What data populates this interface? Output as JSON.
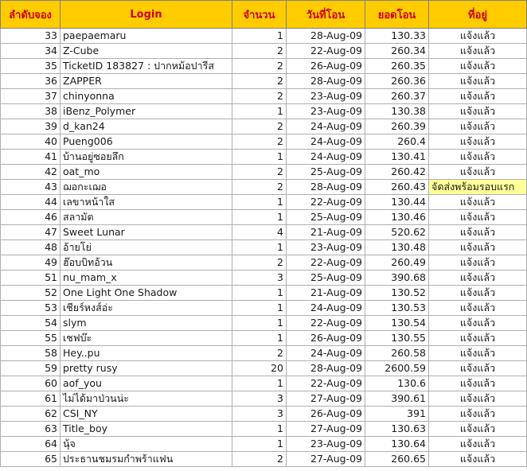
{
  "headers": [
    "ลำดับจอง",
    "Login",
    "จำนวน",
    "วันที่โอน",
    "ยอดโอน",
    "ที่อยู่"
  ],
  "highlight_color": "#ffff99",
  "header_bg": "#ffcc00",
  "header_text_color": "#cc0000",
  "rows": [
    [
      "33",
      "paepaemaru",
      "1",
      "28-Aug-09",
      "130.33",
      "แจ้งแล้ว"
    ],
    [
      "34",
      "Z-Cube",
      "2",
      "22-Aug-09",
      "260.34",
      "แจ้งแล้ว"
    ],
    [
      "35",
      "TicketID 183827 : ปากหม้อปารีส",
      "2",
      "26-Aug-09",
      "260.35",
      "แจ้งแล้ว"
    ],
    [
      "36",
      "ZAPPER",
      "2",
      "28-Aug-09",
      "260.36",
      "แจ้งแล้ว"
    ],
    [
      "37",
      "chinyonna",
      "2",
      "23-Aug-09",
      "260.37",
      "แจ้งแล้ว"
    ],
    [
      "38",
      "iBenz_Polymer",
      "1",
      "23-Aug-09",
      "130.38",
      "แจ้งแล้ว"
    ],
    [
      "39",
      "d_kan24",
      "2",
      "24-Aug-09",
      "260.39",
      "แจ้งแล้ว"
    ],
    [
      "40",
      "Pueng006",
      "2",
      "24-Aug-09",
      "260.4",
      "แจ้งแล้ว"
    ],
    [
      "41",
      "บ้านอยู่ซอยลึก",
      "1",
      "24-Aug-09",
      "130.41",
      "แจ้งแล้ว"
    ],
    [
      "42",
      "oat_mo",
      "2",
      "25-Aug-09",
      "260.42",
      "แจ้งแล้ว"
    ],
    [
      "43",
      "ฌอกะเฌอ",
      "2",
      "28-Aug-09",
      "260.43",
      "จัดส่งพร้อมรอบแรก"
    ],
    [
      "44",
      "เลขาหน้าใส",
      "1",
      "22-Aug-09",
      "130.44",
      "แจ้งแล้ว"
    ],
    [
      "46",
      "สลามัต",
      "1",
      "25-Aug-09",
      "130.46",
      "แจ้งแล้ว"
    ],
    [
      "47",
      "Sweet Lunar",
      "4",
      "21-Aug-09",
      "520.62",
      "แจ้งแล้ว"
    ],
    [
      "48",
      "อ้ายโย่",
      "1",
      "23-Aug-09",
      "130.48",
      "แจ้งแล้ว"
    ],
    [
      "49",
      "ฮ๊อบบิทอ้วน",
      "2",
      "22-Aug-09",
      "260.49",
      "แจ้งแล้ว"
    ],
    [
      "51",
      "nu_mam_x",
      "3",
      "25-Aug-09",
      "390.68",
      "แจ้งแล้ว"
    ],
    [
      "52",
      "One Light One Shadow",
      "1",
      "21-Aug-09",
      "130.52",
      "แจ้งแล้ว"
    ],
    [
      "53",
      "เชียร์หงส์อ่ะ",
      "1",
      "24-Aug-09",
      "130.53",
      "แจ้งแล้ว"
    ],
    [
      "54",
      "slym",
      "1",
      "22-Aug-09",
      "130.54",
      "แจ้งแล้ว"
    ],
    [
      "55",
      "เชฟบ๊ะ",
      "1",
      "26-Aug-09",
      "130.55",
      "แจ้งแล้ว"
    ],
    [
      "58",
      "Hey..pu",
      "2",
      "24-Aug-09",
      "260.58",
      "แจ้งแล้ว"
    ],
    [
      "59",
      "pretty rusy",
      "20",
      "28-Aug-09",
      "2600.59",
      "แจ้งแล้ว"
    ],
    [
      "60",
      "aof_you",
      "1",
      "22-Aug-09",
      "130.6",
      "แจ้งแล้ว"
    ],
    [
      "61",
      "ไม่ได้มาป่วนน่ะ",
      "3",
      "27-Aug-09",
      "390.61",
      "แจ้งแล้ว"
    ],
    [
      "62",
      "CSI_NY",
      "3",
      "26-Aug-09",
      "391",
      "แจ้งแล้ว"
    ],
    [
      "63",
      "Title_boy",
      "1",
      "27-Aug-09",
      "130.63",
      "แจ้งแล้ว"
    ],
    [
      "64",
      " นุ้จ",
      "1",
      "23-Aug-09",
      "130.64",
      "แจ้งแล้ว"
    ],
    [
      "65",
      "ประธานชมรมกำพร้าแฟน",
      "2",
      "27-Aug-09",
      "260.65",
      "แจ้งแล้ว"
    ]
  ]
}
